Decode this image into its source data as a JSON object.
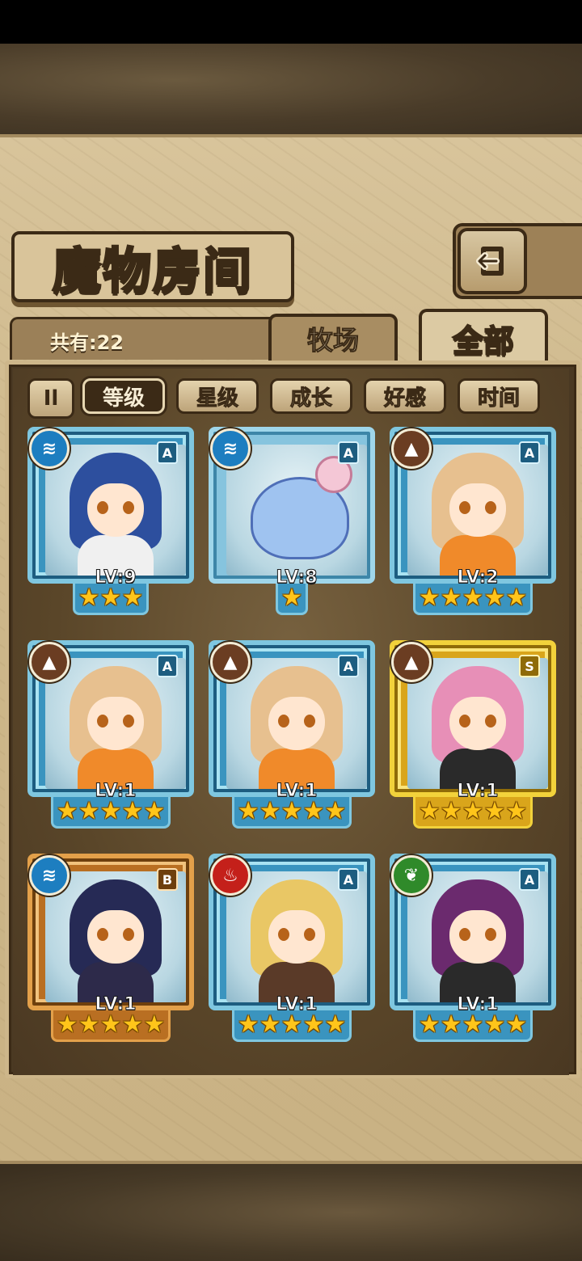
{
  "header": {
    "title": "魔物房间",
    "back_icon": "back-arrow-icon"
  },
  "count_label": "共有:22",
  "tabs": [
    {
      "label": "牧场",
      "active": false
    },
    {
      "label": "全部",
      "active": true
    }
  ],
  "filters": {
    "toggle_label": "Il",
    "options": [
      {
        "label": "等级",
        "active": true
      },
      {
        "label": "星级",
        "active": false
      },
      {
        "label": "成长",
        "active": false
      },
      {
        "label": "好感",
        "active": false
      },
      {
        "label": "时间",
        "active": false
      }
    ]
  },
  "monsters": [
    {
      "level": "LV:9",
      "rank": "A",
      "element": "water-icon",
      "stars": 3,
      "frame": "blue"
    },
    {
      "level": "LV:8",
      "rank": "A",
      "element": "water-icon",
      "stars": 1,
      "frame": "plain"
    },
    {
      "level": "LV:2",
      "rank": "A",
      "element": "earth-icon",
      "stars": 5,
      "frame": "blue"
    },
    {
      "level": "LV:1",
      "rank": "A",
      "element": "earth-icon",
      "stars": 5,
      "frame": "blue"
    },
    {
      "level": "LV:1",
      "rank": "A",
      "element": "earth-icon",
      "stars": 5,
      "frame": "blue"
    },
    {
      "level": "LV:1",
      "rank": "S",
      "element": "earth-icon",
      "stars": 5,
      "frame": "gold"
    },
    {
      "level": "LV:1",
      "rank": "B",
      "element": "water-icon",
      "stars": 5,
      "frame": "bronze"
    },
    {
      "level": "LV:1",
      "rank": "A",
      "element": "fire-icon",
      "stars": 5,
      "frame": "blue"
    },
    {
      "level": "LV:1",
      "rank": "A",
      "element": "wood-icon",
      "stars": 5,
      "frame": "blue"
    }
  ],
  "colors": {
    "water": "#1d7ec0",
    "earth": "#6b3d22",
    "fire": "#c4201a",
    "wood": "#2f8a2a",
    "parchment": "#d8c49b"
  }
}
